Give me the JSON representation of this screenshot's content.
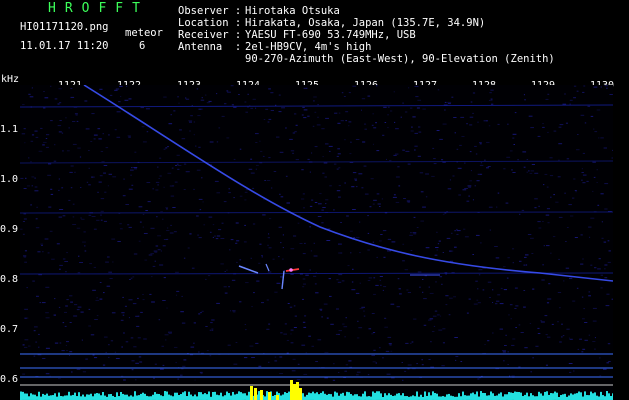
{
  "header": {
    "logo": "HROFFT",
    "filename": "HI01171120.png",
    "datetime": "11.01.17 11:20",
    "meteor_label": "meteor",
    "meteor_count": "6",
    "observer_key": "Observer :",
    "observer_val": "Hirotaka Otsuka",
    "location_key": "Location :",
    "location_val": "Hirakata, Osaka, Japan (135.7E, 34.9N)",
    "receiver_key": "Receiver :",
    "receiver_val": "YAESU FT-690 53.749MHz, USB",
    "antenna_key": "Antenna  :",
    "antenna_val1": "2el-HB9CV, 4m's high",
    "antenna_val2": "90-270-Azimuth (East-West), 90-Elevation (Zenith)"
  },
  "axes": {
    "y_unit": "kHz",
    "y_ticks": [
      "1.1",
      "1.0",
      "0.9",
      "0.8",
      "0.7",
      "0.6"
    ],
    "x_ticks": [
      "1121",
      "1122",
      "1123",
      "1124",
      "1125",
      "1126",
      "1127",
      "1128",
      "1129",
      "1130"
    ]
  },
  "colors": {
    "background": "#000000",
    "noise": "#1a1a8a",
    "trail": "#3c52ff",
    "logo": "#3cff5a",
    "bar": "#ffff00",
    "cyan_base": "#23e0e0"
  }
}
